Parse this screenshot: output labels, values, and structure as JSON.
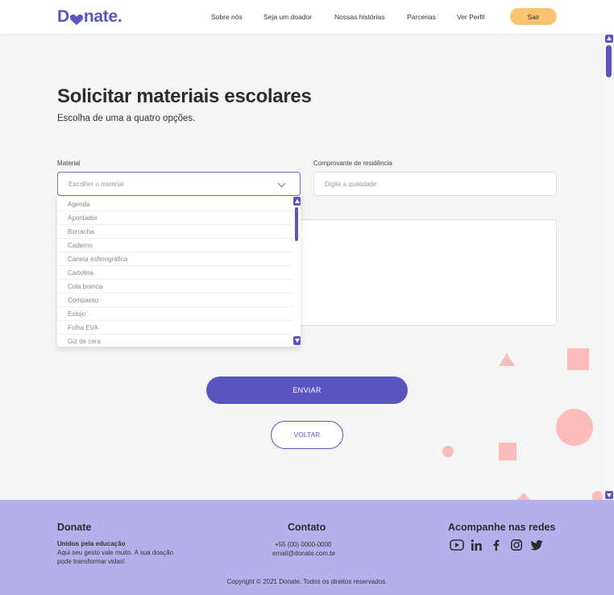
{
  "header": {
    "logo_text_left": "D",
    "logo_text_right": "nate.",
    "nav": [
      "Sobre nós",
      "Seja um doador",
      "Nossas histórias",
      "Parcerias",
      "Ver Perfil"
    ],
    "logout_label": "Sair"
  },
  "main": {
    "title": "Solicitar materiais escolares",
    "subtitle": "Escolha de uma a quatro opções.",
    "material_label": "Material",
    "material_placeholder": "Escolher o material",
    "residencia_label": "Comprovante de residência",
    "residencia_placeholder": "Digite a quatidade",
    "dropdown_options": [
      "Agenda",
      "Apontador",
      "Borracha",
      "Caderno",
      "Caneta esferográfica",
      "Cartolina",
      "Cola branca",
      "Compasso",
      "Estojo",
      "Folha EVA",
      "Giz de cera"
    ],
    "submit_label": "ENVIAR",
    "back_label": "VOLTAR"
  },
  "footer": {
    "col1_title": "Donate",
    "col1_tagline": "Unidos pela educação",
    "col1_text_1": "Aqui seu gesto vale muito. A sua doação",
    "col1_text_2": "pode transformar vidas!",
    "col2_title": "Contato",
    "col2_phone": "+55 (00) 0000-0000",
    "col2_email": "email@donate.com.br",
    "col3_title": "Acompanhe nas redes",
    "social_icons": [
      "youtube-icon",
      "linkedin-icon",
      "facebook-icon",
      "instagram-icon",
      "twitter-icon"
    ],
    "copyright": "Copyright © 2021 Donate. Todos os direitos reservados."
  },
  "colors": {
    "brand": "#5b55c2",
    "accent": "#fcc373",
    "footer_bg": "#b4b0ec",
    "decor": "#fbbcbc"
  }
}
